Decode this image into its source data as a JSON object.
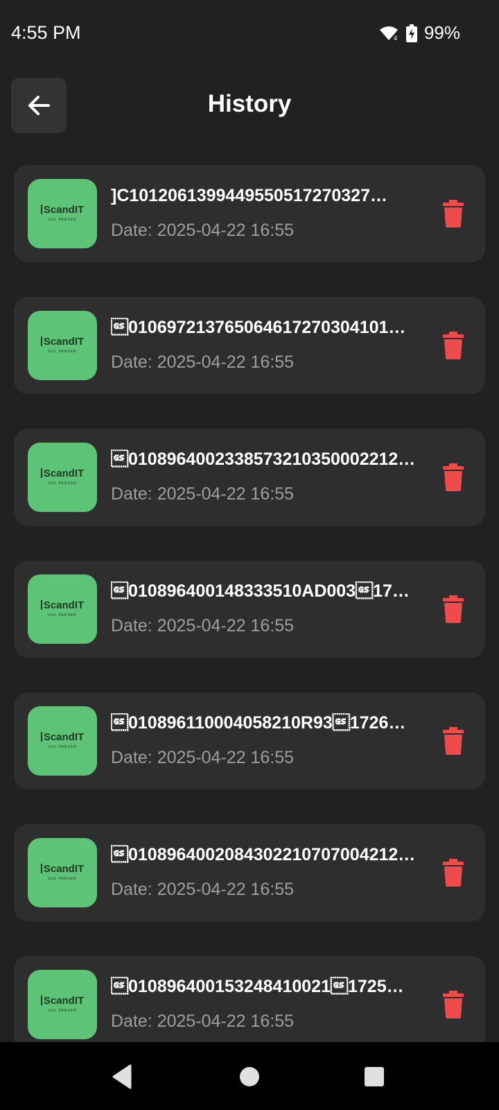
{
  "status_bar": {
    "time": "4:55 PM",
    "battery": "99%",
    "icons": [
      "wifi-icon",
      "battery-charging-icon"
    ]
  },
  "header": {
    "title": "History",
    "back_icon": "arrow-left-icon"
  },
  "logo": {
    "text": "ScandIT",
    "subtitle": "GS1 PARSER"
  },
  "colors": {
    "background": "#212121",
    "card": "#2e2e2e",
    "logo_tile": "#5dc477",
    "delete": "#f04b4b",
    "date_text": "#9e9e9e"
  },
  "history_items": [
    {
      "code": "]C1012061399449550517270327…",
      "date": "Date: 2025-04-22 16:55"
    },
    {
      "code": "\u001d010697213765064617270304101…",
      "date": "Date: 2025-04-22 16:55"
    },
    {
      "code": "\u001d0108964002338573210350002212…",
      "date": "Date: 2025-04-22 16:55"
    },
    {
      "code": "\u001d010896400148333510AD003\u001d17…",
      "date": "Date: 2025-04-22 16:55"
    },
    {
      "code": "\u001d010896110004058210R93\u001d1726…",
      "date": "Date: 2025-04-22 16:55"
    },
    {
      "code": "\u001d0108964002084302210707004212…",
      "date": "Date: 2025-04-22 16:55"
    },
    {
      "code": "\u001d010896400153248410021\u001d1725…",
      "date": "Date: 2025-04-22 16:55"
    }
  ],
  "nav_bar": {
    "buttons": [
      "back-triangle-icon",
      "home-circle-icon",
      "recents-square-icon"
    ]
  }
}
